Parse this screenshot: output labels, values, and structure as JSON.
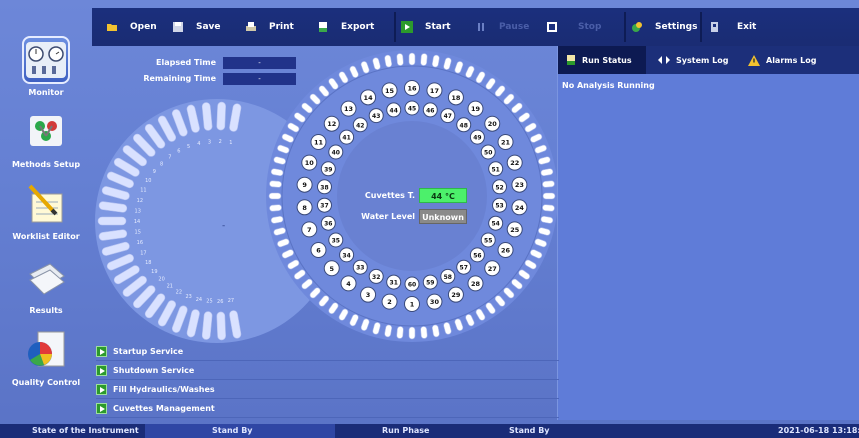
{
  "toolbar": {
    "open": "Open",
    "save": "Save",
    "print": "Print",
    "export": "Export",
    "start": "Start",
    "pause": "Pause",
    "stop": "Stop",
    "settings": "Settings",
    "exit": "Exit"
  },
  "nav": {
    "items": [
      {
        "label": "Monitor",
        "icon": "monitor-clocks-icon"
      },
      {
        "label": "Methods Setup",
        "icon": "methods-flask-icon"
      },
      {
        "label": "Worklist Editor",
        "icon": "worklist-pencil-icon"
      },
      {
        "label": "Results",
        "icon": "results-papers-icon"
      },
      {
        "label": "Quality Control",
        "icon": "quality-control-chart-icon"
      }
    ]
  },
  "timing": {
    "elapsed_label": "Elapsed Time",
    "elapsed_value": "-",
    "remaining_label": "Remaining Time",
    "remaining_value": "-"
  },
  "cuvettes": {
    "temp_label": "Cuvettes T.",
    "temp_value": "44 °C",
    "water_label": "Water Level",
    "water_value": "Unknown",
    "outer_ring": [
      "1",
      "2",
      "3",
      "4",
      "5",
      "6",
      "7",
      "8",
      "9",
      "10",
      "11",
      "12",
      "13",
      "14",
      "15",
      "16",
      "17",
      "18",
      "19",
      "20",
      "21",
      "22",
      "23",
      "24",
      "25",
      "26",
      "27",
      "28",
      "29",
      "30"
    ],
    "inner_ring": [
      "31",
      "32",
      "33",
      "34",
      "35",
      "36",
      "37",
      "38",
      "39",
      "40",
      "41",
      "42",
      "43",
      "44",
      "45",
      "46",
      "47",
      "48",
      "49",
      "50",
      "51",
      "52",
      "53",
      "54",
      "55",
      "56",
      "57",
      "58",
      "59",
      "60"
    ],
    "left_label": "-"
  },
  "left_wheel_numbers": [
    "1",
    "2",
    "3",
    "4",
    "5",
    "6",
    "7",
    "8",
    "9",
    "10",
    "11",
    "12",
    "13",
    "14",
    "15",
    "16",
    "17",
    "18",
    "19",
    "20",
    "21",
    "22",
    "23",
    "24",
    "25",
    "26",
    "27"
  ],
  "right_panel": {
    "tabs": [
      "Run Status",
      "System Log",
      "Alarms Log"
    ],
    "status": "No Analysis Running"
  },
  "services": [
    "Startup Service",
    "Shutdown Service",
    "Fill Hydraulics/Washes",
    "Cuvettes Management"
  ],
  "statusbar": {
    "state_label": "State of the Instrument",
    "state_value": "Stand By",
    "phase_label": "Run Phase",
    "phase_value": "Stand By",
    "datetime": "2021-06-18 13:18:"
  },
  "colors": {
    "temp_ok": "#4cf06b",
    "water_unknown": "#8a8a8a",
    "toolbar_bg": "#1b2f7d"
  }
}
